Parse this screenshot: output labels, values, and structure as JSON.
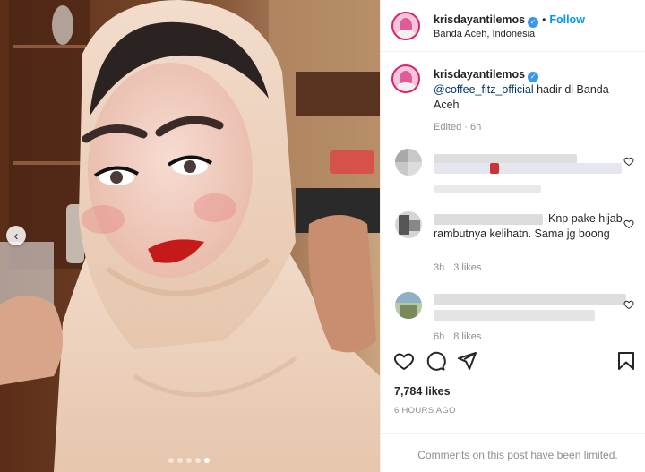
{
  "post": {
    "username": "krisdayantilemos",
    "follow_separator": "•",
    "follow_label": "Follow",
    "location": "Banda Aceh, Indonesia",
    "verified_mark": "✓"
  },
  "caption": {
    "username": "krisdayantilemos",
    "mention": "@coffee_fitz_official",
    "text": " hadir di Banda Aceh",
    "meta": "Edited · 6h"
  },
  "comments": [
    {
      "text": "",
      "time": "",
      "likes": ""
    },
    {
      "text": "Knp pake hijab rambutnya kelihatn. Sama jg boong",
      "time": "3h",
      "likes": "3 likes"
    },
    {
      "text": "",
      "time": "6h",
      "likes": "8 likes"
    }
  ],
  "stats": {
    "likes": "7,784 likes",
    "time_ago": "6 HOURS AGO"
  },
  "footer": {
    "limited_notice": "Comments on this post have been limited."
  },
  "media": {
    "prev_arrow": "‹",
    "slide_count": 5,
    "active_slide": 5
  },
  "icons": {
    "like": "heart-icon",
    "comment": "comment-icon",
    "share": "paper-plane-icon",
    "save": "bookmark-icon",
    "comment_like": "heart-icon"
  },
  "colors": {
    "accent": "#0095f6",
    "verified": "#3897f0",
    "mention": "#00376b",
    "muted": "#8e8e8e"
  }
}
